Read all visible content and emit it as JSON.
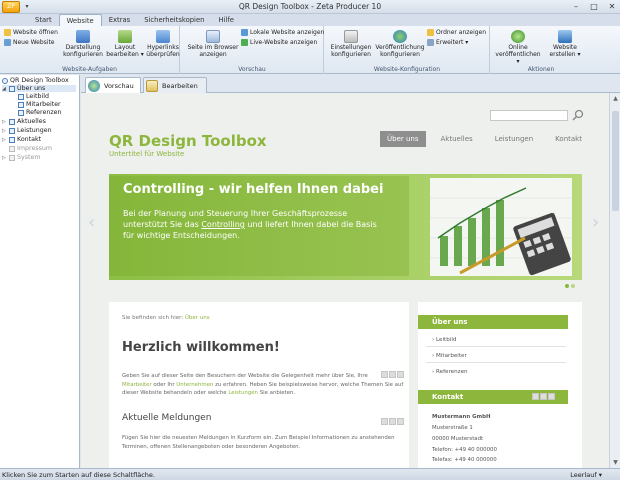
{
  "window": {
    "title": "QR Design Toolbox - Zeta Producer 10"
  },
  "quick_access": {
    "app_button": "ZP"
  },
  "tabs": [
    "Start",
    "Website",
    "Extras",
    "Sicherheitskopien",
    "Hilfe"
  ],
  "active_tab": "Website",
  "ribbon": {
    "groups": [
      {
        "label": "Website-Aufgaben",
        "small": [
          "Website öffnen",
          "Neue Website"
        ],
        "large": [
          "Darstellung konfigurieren",
          "Layout bearbeiten ▾",
          "Hyperlinks überprüfen"
        ]
      },
      {
        "label": "Vorschau",
        "large": [
          "Seite im Browser anzeigen"
        ],
        "small": [
          "Lokale Website anzeigen",
          "Live-Website anzeigen"
        ]
      },
      {
        "label": "Website-Konfiguration",
        "large": [
          "Einstellungen konfigurieren",
          "Veröffentlichung konfigurieren"
        ],
        "small": [
          "Ordner anzeigen",
          "Erweitert ▾"
        ]
      },
      {
        "label": "Aktionen",
        "large": [
          "Online veröffentlichen ▾",
          "Website erstellen ▾"
        ]
      }
    ]
  },
  "tree": [
    {
      "label": "QR Design Toolbox",
      "level": 0
    },
    {
      "label": "Über uns",
      "level": 1
    },
    {
      "label": "Leitbild",
      "level": 2
    },
    {
      "label": "Mitarbeiter",
      "level": 2
    },
    {
      "label": "Referenzen",
      "level": 2
    },
    {
      "label": "Aktuelles",
      "level": 1
    },
    {
      "label": "Leistungen",
      "level": 1
    },
    {
      "label": "Kontakt",
      "level": 1
    },
    {
      "label": "Impressum",
      "level": 1
    },
    {
      "label": "System",
      "level": 1
    }
  ],
  "doc_tabs": [
    "Vorschau",
    "Bearbeiten"
  ],
  "site": {
    "title": "QR Design Toolbox",
    "subtitle": "Untertitel für Website",
    "nav": [
      "Über uns",
      "Aktuelles",
      "Leistungen",
      "Kontakt"
    ],
    "slider": {
      "heading": "Controlling - wir helfen Ihnen dabei",
      "text_a": "Bei der Planung und Steuerung Ihrer Geschäftsprozesse unterstützt Sie das ",
      "text_link": "Controlling",
      "text_b": " und liefert Ihnen dabei die Basis für wichtige Entscheidungen."
    },
    "breadcrumb_label": "Sie befinden sich hier:",
    "breadcrumb_link": "Über uns",
    "welcome": "Herzlich willkommen!",
    "intro_1": "Geben Sie auf dieser Seite den Besuchern der Website die Gelegenheit mehr über Sie, Ihre",
    "intro_2a": "Mitarbeiter",
    "intro_2b": " oder Ihr ",
    "intro_2c": "Unternehmen",
    "intro_2d": " zu erfahren. Heben Sie beispielsweise hervor, welche Themen Sie auf",
    "intro_3a": "dieser Website behandeln oder welche ",
    "intro_3b": "Leistungen",
    "intro_3c": " Sie anbieten.",
    "news_heading": "Aktuelle Meldungen",
    "news_1": "Fügen Sie hier die neuesten Meldungen in Kurzform ein. Zum Beispiel Informationen zu anstehenden",
    "news_2": "Terminen, offenen Stellenangeboten oder besonderen Angeboten.",
    "sidebox_about": "Über uns",
    "sidebox_links": [
      "Leitbild",
      "Mitarbeiter",
      "Referenzen"
    ],
    "sidebox_contact": "Kontakt",
    "contact": [
      "Mustermann GmbH",
      "Musterstraße 1",
      "00000 Musterstadt",
      "Telefon: +49 40 000000",
      "Telefax: +49 40 000000"
    ]
  },
  "status": {
    "left": "Klicken Sie zum Starten auf diese Schaltfläche.",
    "right": "Leerlauf ▾"
  },
  "colors": {
    "accent": "#8db63c",
    "nav_active": "#8e8e8e"
  }
}
